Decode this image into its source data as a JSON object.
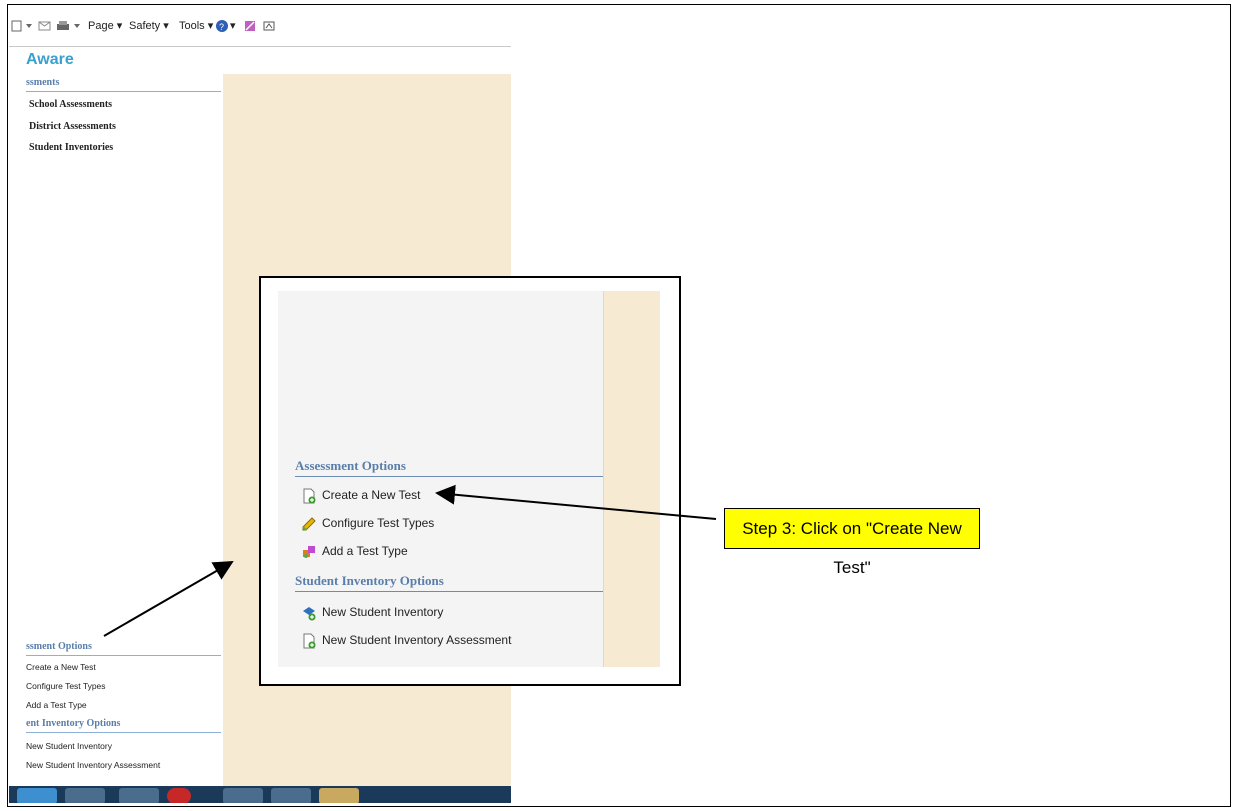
{
  "toolbar": {
    "page": "Page ▾",
    "safety": "Safety ▾",
    "tools": "Tools ▾",
    "help_caret": "▾"
  },
  "app": {
    "title": "Aware"
  },
  "sidebar": {
    "assessments_heading": "ssments",
    "links": [
      "School Assessments",
      "District Assessments",
      "Student Inventories"
    ],
    "assessment_options_heading": "ssment Options",
    "assessment_options": [
      "Create a New Test",
      "Configure Test Types",
      "Add a Test Type"
    ],
    "inventory_options_heading": "ent Inventory Options",
    "inventory_options": [
      "New Student Inventory",
      "New Student Inventory Assessment"
    ]
  },
  "inset": {
    "assessment_options_heading": "Assessment Options",
    "assessment_options": [
      "Create a New Test",
      "Configure Test Types",
      "Add a Test Type"
    ],
    "inventory_options_heading": "Student Inventory Options",
    "inventory_options": [
      "New Student Inventory",
      "New Student Inventory Assessment"
    ]
  },
  "callout": {
    "text": "Step 3: Click on \"Create New Test\""
  }
}
